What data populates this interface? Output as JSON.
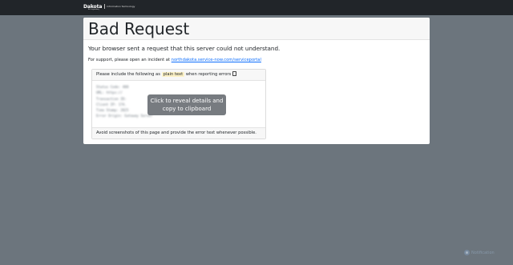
{
  "header": {
    "logo_word": "Dakota",
    "logo_sub": "Be Legendary",
    "logo_dept": "Information Technology"
  },
  "main": {
    "title": "Bad Request",
    "lead": "Your browser sent a request that this server could not understand.",
    "support_prefix": "For support, please open an incident at ",
    "support_link": "northdakota.service-now.com/serviceportal"
  },
  "details_box": {
    "head_prefix": "Please include the following as ",
    "head_highlight": "plain text",
    "head_suffix": " when reporting errors",
    "blurred_lines": [
      "Status Code: 400",
      "URL: https://",
      "Transaction ID: ",
      "Client IP: 174.",
      "Time Stamp: 2025",
      "Error Origin: Gateway Server"
    ],
    "reveal_label": "Click to reveal details and copy to clipboard",
    "footer": "Avoid screenshots of this page and provide the error text whenever possible."
  },
  "watermark": {
    "label": "Notification",
    "icon": "notification-icon"
  }
}
